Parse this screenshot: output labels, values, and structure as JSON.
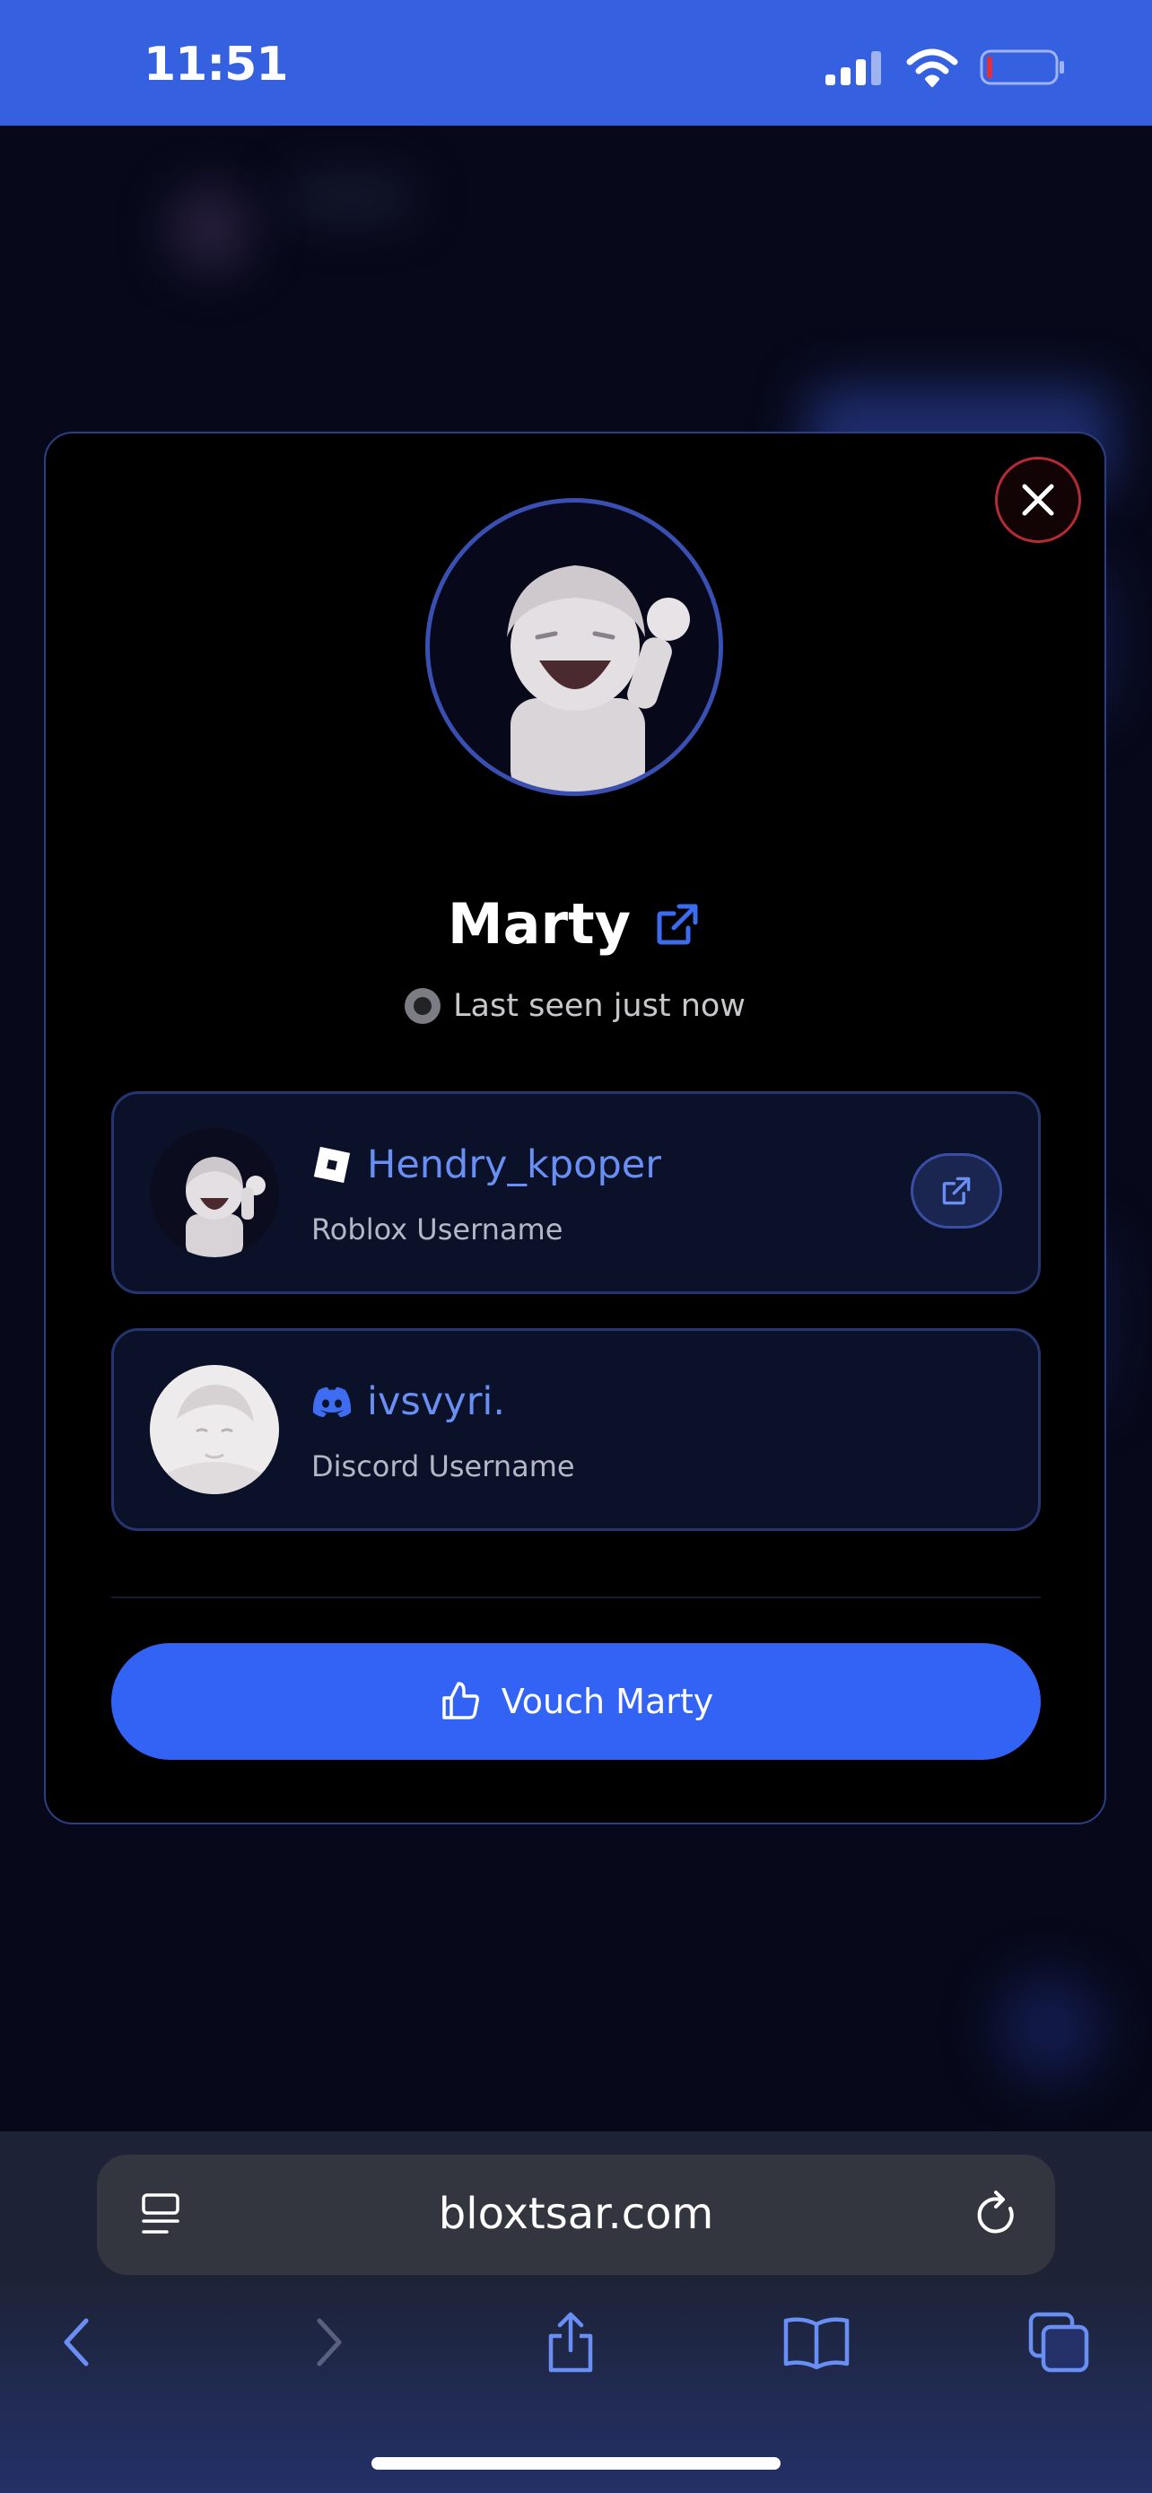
{
  "status_bar": {
    "time": "11:51"
  },
  "profile": {
    "display_name": "Marty",
    "last_seen": "Last seen just now"
  },
  "accounts": [
    {
      "username": "Hendry_kpoper",
      "label": "Roblox Username",
      "platform": "roblox"
    },
    {
      "username": "ivsvyri.",
      "label": "Discord Username",
      "platform": "discord"
    }
  ],
  "actions": {
    "vouch_label": "Vouch Marty"
  },
  "browser": {
    "url": "bloxtsar.com"
  },
  "colors": {
    "accent": "#3363f4",
    "status_bar": "#3560e0",
    "close_border": "#b52b35",
    "link": "#6a8ff4"
  }
}
